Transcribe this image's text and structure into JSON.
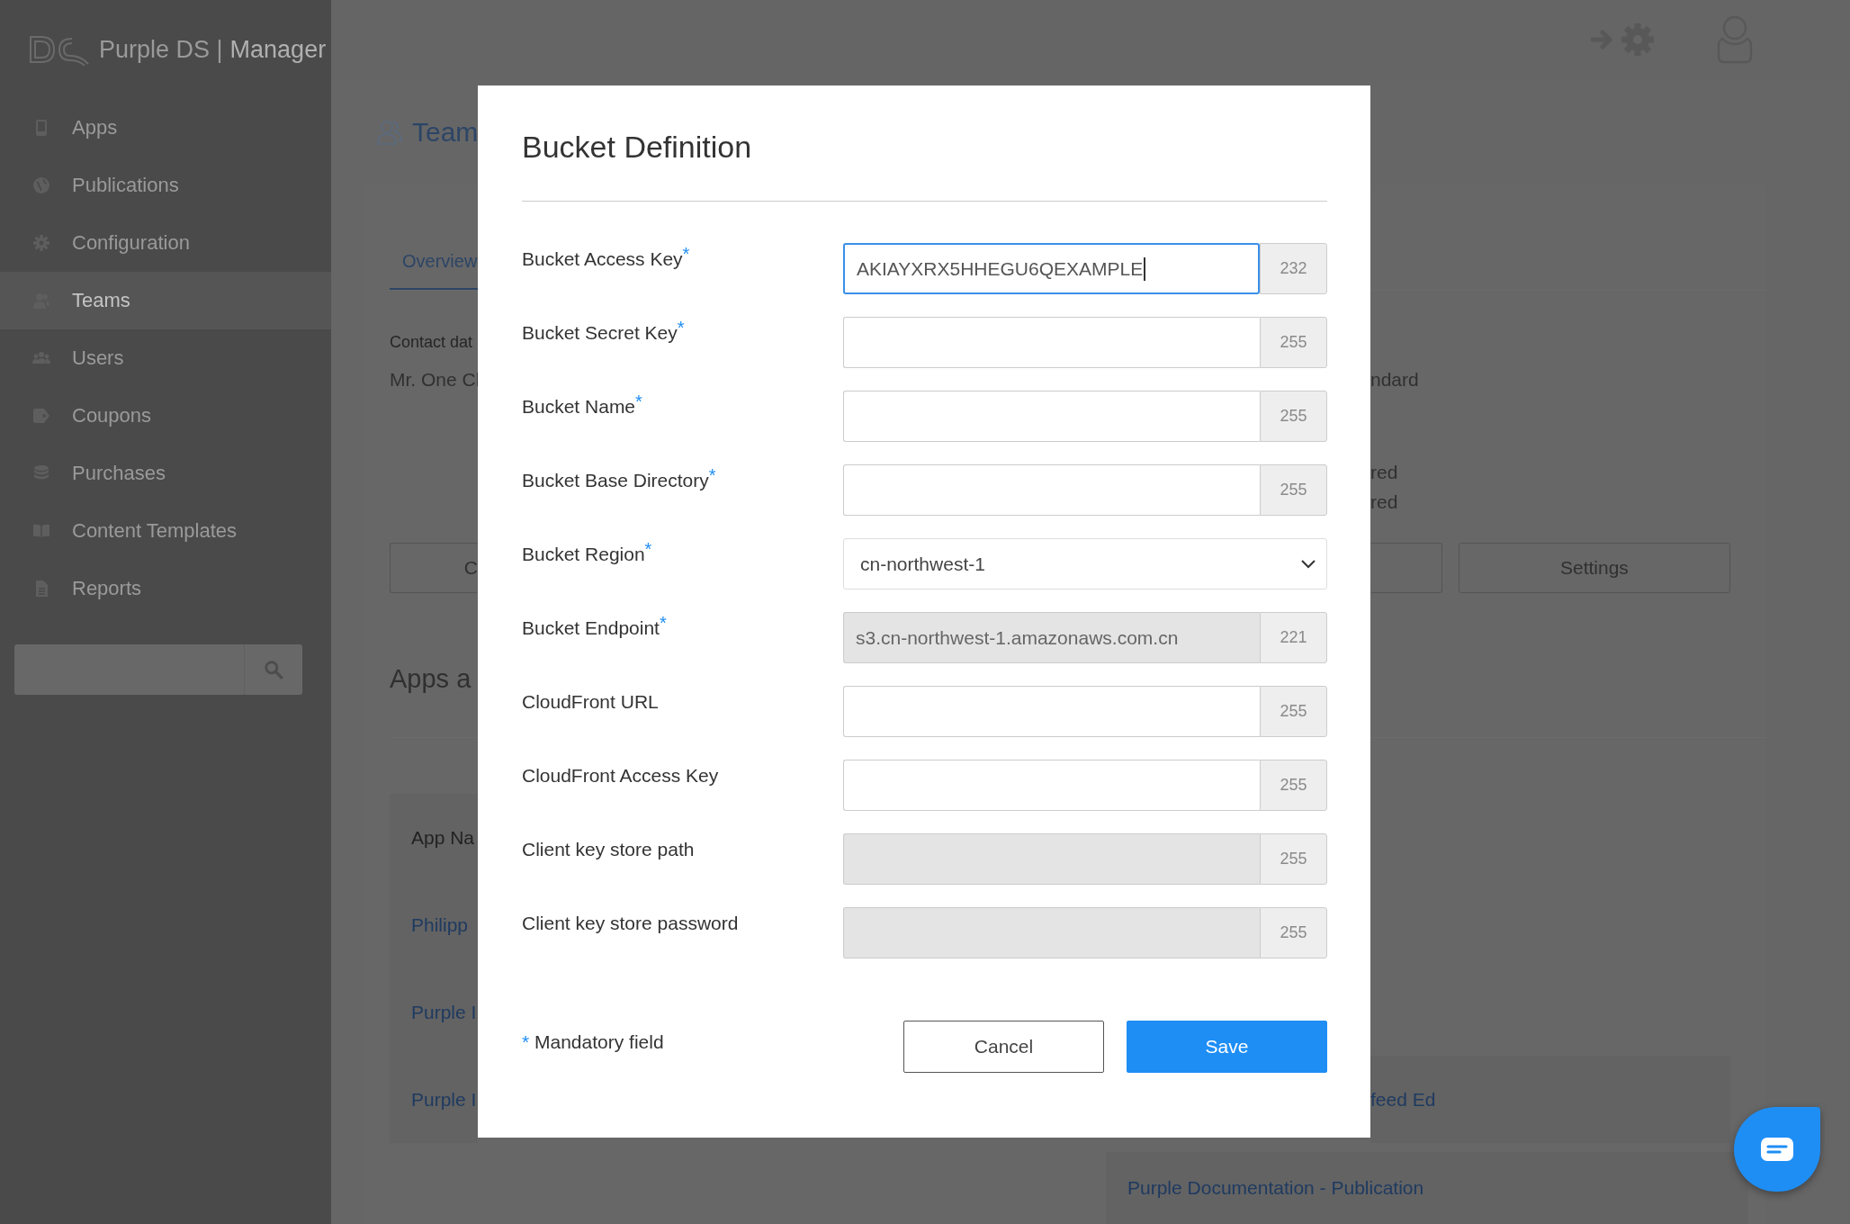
{
  "brand": {
    "name": "Purple DS |",
    "product": "Manager"
  },
  "sidebar": {
    "items": [
      {
        "label": "Apps",
        "selected": false
      },
      {
        "label": "Publications",
        "selected": false
      },
      {
        "label": "Configuration",
        "selected": false
      },
      {
        "label": "Teams",
        "selected": true
      },
      {
        "label": "Users",
        "selected": false
      },
      {
        "label": "Coupons",
        "selected": false
      },
      {
        "label": "Purchases",
        "selected": false
      },
      {
        "label": "Content Templates",
        "selected": false
      },
      {
        "label": "Reports",
        "selected": false
      }
    ]
  },
  "page": {
    "title": "Team",
    "tabs": [
      {
        "label": "Overview",
        "selected": true
      }
    ],
    "contact_label": "Contact dat",
    "contact_name": "Mr. One Cl",
    "right_texts": [
      "ndard",
      "red",
      "red"
    ],
    "left_button": "C",
    "settings_button": "Settings",
    "apps_title": "Apps a",
    "table": {
      "header": "App Na",
      "rows": [
        {
          "left": "Philipp"
        },
        {
          "left": "Purple I"
        },
        {
          "left": "Purple I",
          "right": "feed Ed"
        }
      ]
    },
    "last_row": "Purple Documentation - Publication"
  },
  "dialog": {
    "title": "Bucket Definition",
    "fields": [
      {
        "label": "Bucket Access Key",
        "required_mark": "*",
        "kind": "text",
        "value": "AKIAYXRX5HHEGU6QEXAMPLE",
        "counter": "232",
        "focused": true,
        "disabled": false
      },
      {
        "label": "Bucket Secret Key",
        "required_mark": "*",
        "kind": "text",
        "counter": "255",
        "focused": false,
        "disabled": false
      },
      {
        "label": "Bucket Name",
        "required_mark": "*",
        "kind": "text",
        "counter": "255",
        "focused": false,
        "disabled": false
      },
      {
        "label": "Bucket Base Directory",
        "required_mark": "*",
        "kind": "text",
        "counter": "255",
        "focused": false,
        "disabled": false
      },
      {
        "label": "Bucket Region",
        "required_mark": "*",
        "kind": "select",
        "value": "cn-northwest-1",
        "focused": false,
        "disabled": false
      },
      {
        "label": "Bucket Endpoint",
        "required_mark": "*",
        "kind": "text",
        "value": "s3.cn-northwest-1.amazonaws.com.cn",
        "counter": "221",
        "focused": false,
        "disabled": true
      },
      {
        "label": "CloudFront URL",
        "kind": "text",
        "counter": "255",
        "focused": false,
        "disabled": false
      },
      {
        "label": "CloudFront Access Key",
        "kind": "text",
        "counter": "255",
        "focused": false,
        "disabled": false
      },
      {
        "label": "Client key store path",
        "kind": "text",
        "counter": "255",
        "focused": false,
        "disabled": true
      },
      {
        "label": "Client key store password",
        "kind": "text",
        "counter": "255",
        "focused": false,
        "disabled": true
      }
    ],
    "note_mark": "*",
    "note": "Mandatory field",
    "buttons": [
      {
        "label": "Cancel",
        "kind": "secondary"
      },
      {
        "label": "Save",
        "kind": "primary"
      }
    ]
  }
}
